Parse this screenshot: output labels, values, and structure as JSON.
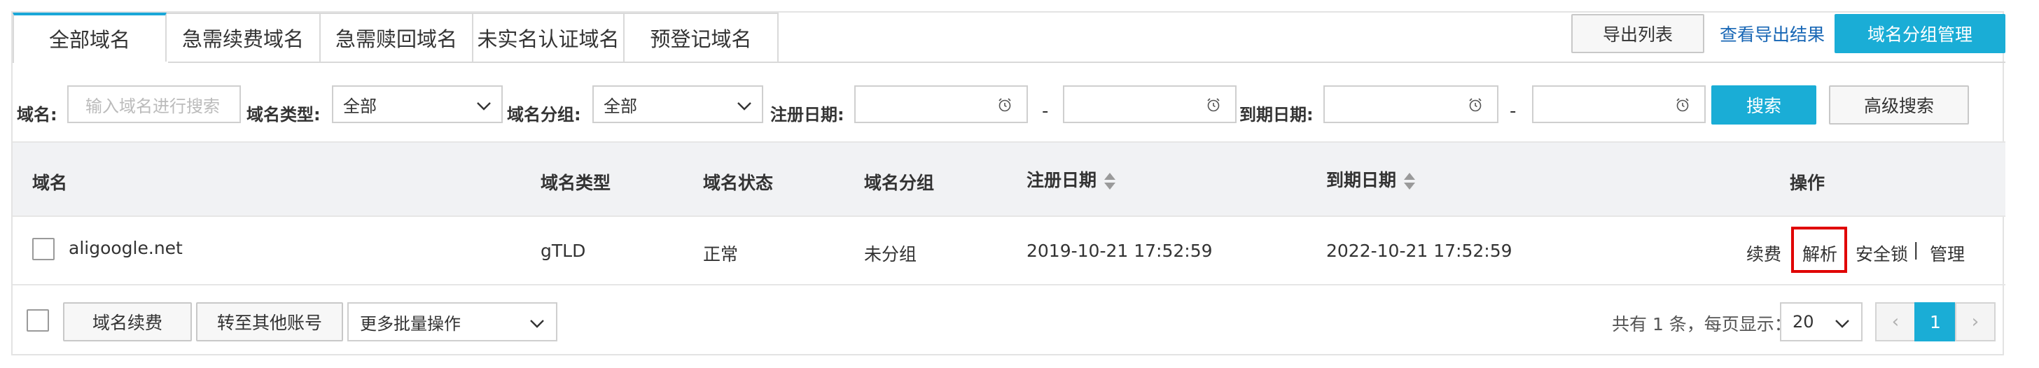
{
  "tabs": [
    {
      "label": "全部域名",
      "active": true
    },
    {
      "label": "急需续费域名",
      "active": false
    },
    {
      "label": "急需赎回域名",
      "active": false
    },
    {
      "label": "未实名认证域名",
      "active": false
    },
    {
      "label": "预登记域名",
      "active": false
    }
  ],
  "header_actions": {
    "export_list": "导出列表",
    "view_export": "查看导出结果",
    "group_manage": "域名分组管理"
  },
  "filters": {
    "domain_label": "域名:",
    "domain_placeholder": "输入域名进行搜索",
    "type_label": "域名类型:",
    "type_value": "全部",
    "group_label": "域名分组:",
    "group_value": "全部",
    "reg_date_label": "注册日期:",
    "exp_date_label": "到期日期:",
    "range_separator": "-",
    "search": "搜索",
    "advanced_search": "高级搜索"
  },
  "table": {
    "headers": {
      "domain": "域名",
      "type": "域名类型",
      "status": "域名状态",
      "group": "域名分组",
      "reg_date": "注册日期",
      "exp_date": "到期日期",
      "actions": "操作"
    },
    "rows": [
      {
        "domain": "aligoogle.net",
        "type": "gTLD",
        "status": "正常",
        "group": "未分组",
        "reg_date": "2019-10-21 17:52:59",
        "exp_date": "2022-10-21 17:52:59",
        "actions": {
          "renew": "续费",
          "resolve": "解析",
          "lock": "安全锁",
          "separator": "|",
          "manage": "管理"
        }
      }
    ]
  },
  "footer": {
    "batch_renew": "域名续费",
    "transfer": "转至其他账号",
    "more_batch": "更多批量操作",
    "total_text": "共有 1 条，每页显示：",
    "page_size": "20",
    "current_page": "1",
    "prev": "‹",
    "next": "›"
  },
  "colors": {
    "accent": "#1aadd6",
    "link": "#1766b5",
    "highlight": "#e00000"
  }
}
